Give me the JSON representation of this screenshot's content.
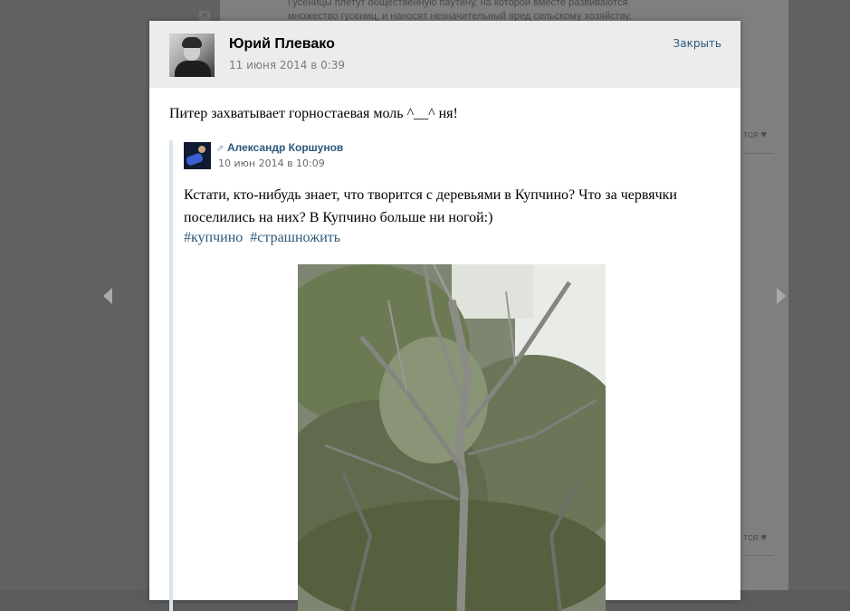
{
  "background": {
    "text_line_1": "Гусеницы плетут общественную паутину, на которой вместе развиваются",
    "text_line_2": "множество гусениц, и наносят незначительный вред сельскому хозяйству.",
    "likes_label_1": "тся",
    "likes_label_2": "тся"
  },
  "post": {
    "author_name": "Юрий Плевако",
    "date": "11 июня 2014 в 0:39",
    "close_label": "Закрыть",
    "text": "Питер захватывает горностаевая моль ^__^ ня!"
  },
  "repost": {
    "author_name": "Александр Коршунов",
    "date": "10 июн 2014 в 10:09",
    "text": "Кстати, кто-нибудь знает, что творится с деревьями в Купчино? Что за червячки поселились на них? В Купчино больше ни ногой:)",
    "hashtags": [
      "#купчино",
      "#страшножить"
    ]
  },
  "icons": {
    "prev": "chevron-left-icon",
    "next": "chevron-right-icon",
    "repost": "repost-arrow-icon",
    "heart": "heart-icon"
  },
  "colors": {
    "link": "#2b587a",
    "header_bg": "#ececec",
    "overlay": "#5b5b5b"
  }
}
